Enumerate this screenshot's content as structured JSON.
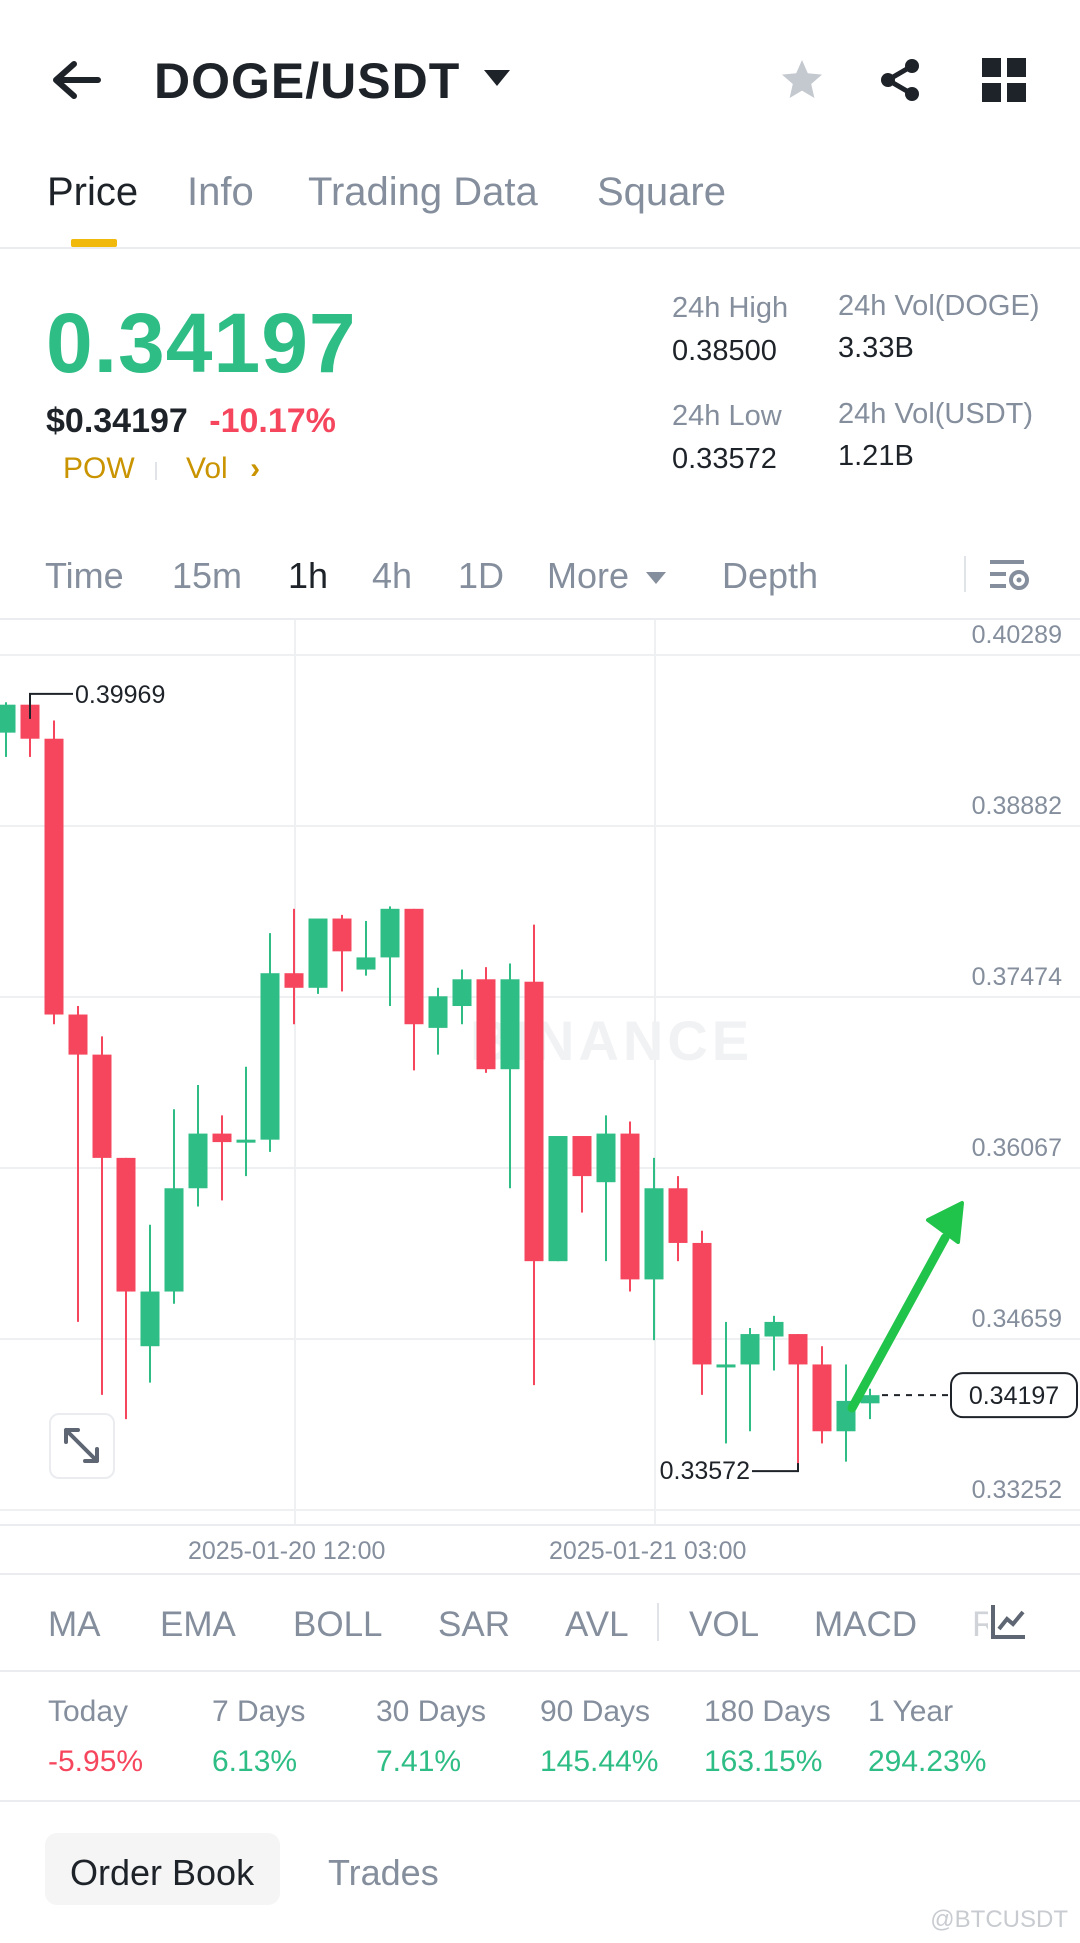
{
  "header": {
    "pair": "DOGE/USDT"
  },
  "tabs": [
    "Price",
    "Info",
    "Trading Data",
    "Square"
  ],
  "price": {
    "last": "0.34197",
    "usd": "$0.34197",
    "change": "-10.17%",
    "tag": "POW",
    "vol_link": "Vol"
  },
  "stats": {
    "high_label": "24h High",
    "high": "0.38500",
    "low_label": "24h Low",
    "low": "0.33572",
    "vol_doge_label": "24h Vol(DOGE)",
    "vol_doge": "3.33B",
    "vol_usdt_label": "24h Vol(USDT)",
    "vol_usdt": "1.21B"
  },
  "intervals": [
    "Time",
    "15m",
    "1h",
    "4h",
    "1D",
    "More",
    "Depth"
  ],
  "icons": {
    "back": "back-arrow-icon",
    "dropdown": "caret-down-icon",
    "favorite": "star-icon",
    "share": "share-icon",
    "grid": "grid-icon",
    "chart_settings": "chart-settings-icon",
    "expand": "expand-icon",
    "indicator_settings": "indicator-settings-icon"
  },
  "colors": {
    "up": "#2ebd85",
    "down": "#f6465d",
    "accent": "#f0b90b"
  },
  "chart_data": {
    "type": "candlestick",
    "y_ticks": [
      "0.40289",
      "0.38882",
      "0.37474",
      "0.36067",
      "0.34659",
      "0.33252"
    ],
    "ylim": [
      0.33252,
      0.40289
    ],
    "x_ticks": [
      "2025-01-20 12:00",
      "2025-01-21 03:00"
    ],
    "high_annotation": "0.39969",
    "low_annotation": "0.33572",
    "last_price_label": "0.34197",
    "candles": [
      {
        "o": 0.3965,
        "h": 0.399,
        "l": 0.3945,
        "c": 0.3988
      },
      {
        "o": 0.3988,
        "h": 0.3997,
        "l": 0.3945,
        "c": 0.396
      },
      {
        "o": 0.396,
        "h": 0.3975,
        "l": 0.3725,
        "c": 0.3733
      },
      {
        "o": 0.3733,
        "h": 0.374,
        "l": 0.348,
        "c": 0.37
      },
      {
        "o": 0.37,
        "h": 0.3715,
        "l": 0.342,
        "c": 0.3615
      },
      {
        "o": 0.3615,
        "h": 0.3615,
        "l": 0.34,
        "c": 0.3505
      },
      {
        "o": 0.346,
        "h": 0.356,
        "l": 0.343,
        "c": 0.3505
      },
      {
        "o": 0.3505,
        "h": 0.3655,
        "l": 0.3495,
        "c": 0.359
      },
      {
        "o": 0.359,
        "h": 0.3675,
        "l": 0.3575,
        "c": 0.3635
      },
      {
        "o": 0.3635,
        "h": 0.365,
        "l": 0.358,
        "c": 0.3628
      },
      {
        "o": 0.363,
        "h": 0.369,
        "l": 0.36,
        "c": 0.363
      },
      {
        "o": 0.363,
        "h": 0.38,
        "l": 0.362,
        "c": 0.3767
      },
      {
        "o": 0.3767,
        "h": 0.382,
        "l": 0.3725,
        "c": 0.3755
      },
      {
        "o": 0.3755,
        "h": 0.3805,
        "l": 0.375,
        "c": 0.3812
      },
      {
        "o": 0.3812,
        "h": 0.3815,
        "l": 0.3752,
        "c": 0.3785
      },
      {
        "o": 0.377,
        "h": 0.381,
        "l": 0.3765,
        "c": 0.378
      },
      {
        "o": 0.378,
        "h": 0.3822,
        "l": 0.374,
        "c": 0.382
      },
      {
        "o": 0.382,
        "h": 0.382,
        "l": 0.3687,
        "c": 0.3725
      },
      {
        "o": 0.3722,
        "h": 0.3755,
        "l": 0.37,
        "c": 0.3748
      },
      {
        "o": 0.374,
        "h": 0.377,
        "l": 0.3725,
        "c": 0.3762
      },
      {
        "o": 0.3762,
        "h": 0.3772,
        "l": 0.3685,
        "c": 0.3688
      },
      {
        "o": 0.3688,
        "h": 0.3775,
        "l": 0.359,
        "c": 0.3762
      },
      {
        "o": 0.376,
        "h": 0.3807,
        "l": 0.3428,
        "c": 0.353
      },
      {
        "o": 0.353,
        "h": 0.363,
        "l": 0.353,
        "c": 0.3633
      },
      {
        "o": 0.3633,
        "h": 0.363,
        "l": 0.357,
        "c": 0.36
      },
      {
        "o": 0.3595,
        "h": 0.365,
        "l": 0.353,
        "c": 0.3635
      },
      {
        "o": 0.3635,
        "h": 0.3645,
        "l": 0.3505,
        "c": 0.3515
      },
      {
        "o": 0.3515,
        "h": 0.3615,
        "l": 0.3465,
        "c": 0.359
      },
      {
        "o": 0.359,
        "h": 0.36,
        "l": 0.353,
        "c": 0.3545
      },
      {
        "o": 0.3545,
        "h": 0.3555,
        "l": 0.342,
        "c": 0.3445
      },
      {
        "o": 0.3445,
        "h": 0.348,
        "l": 0.338,
        "c": 0.3445
      },
      {
        "o": 0.3445,
        "h": 0.3475,
        "l": 0.339,
        "c": 0.347
      },
      {
        "o": 0.3468,
        "h": 0.3485,
        "l": 0.344,
        "c": 0.348
      },
      {
        "o": 0.347,
        "h": 0.347,
        "l": 0.3357,
        "c": 0.3445
      },
      {
        "o": 0.3445,
        "h": 0.346,
        "l": 0.338,
        "c": 0.339
      },
      {
        "o": 0.339,
        "h": 0.3445,
        "l": 0.3365,
        "c": 0.3415
      },
      {
        "o": 0.3413,
        "h": 0.3425,
        "l": 0.34,
        "c": 0.34197
      }
    ]
  },
  "indicators": [
    "MA",
    "EMA",
    "BOLL",
    "SAR",
    "AVL",
    "VOL",
    "MACD",
    "R"
  ],
  "performance": [
    {
      "label": "Today",
      "value": "-5.95%"
    },
    {
      "label": "7 Days",
      "value": "6.13%"
    },
    {
      "label": "30 Days",
      "value": "7.41%"
    },
    {
      "label": "90 Days",
      "value": "145.44%"
    },
    {
      "label": "180 Days",
      "value": "163.15%"
    },
    {
      "label": "1 Year",
      "value": "294.23%"
    }
  ],
  "bottom_tabs": [
    "Order Book",
    "Trades"
  ],
  "watermark": "@BTCUSDT"
}
